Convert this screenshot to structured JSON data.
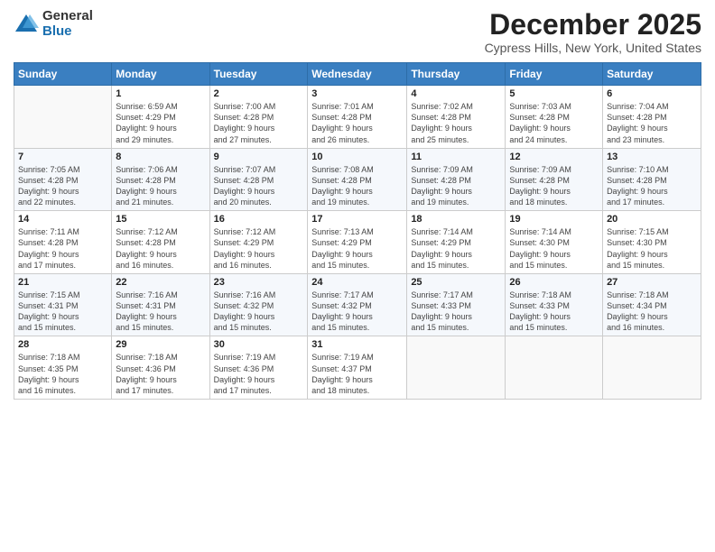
{
  "logo": {
    "general": "General",
    "blue": "Blue"
  },
  "title": "December 2025",
  "location": "Cypress Hills, New York, United States",
  "weekdays": [
    "Sunday",
    "Monday",
    "Tuesday",
    "Wednesday",
    "Thursday",
    "Friday",
    "Saturday"
  ],
  "weeks": [
    [
      {
        "day": "",
        "info": ""
      },
      {
        "day": "1",
        "info": "Sunrise: 6:59 AM\nSunset: 4:29 PM\nDaylight: 9 hours\nand 29 minutes."
      },
      {
        "day": "2",
        "info": "Sunrise: 7:00 AM\nSunset: 4:28 PM\nDaylight: 9 hours\nand 27 minutes."
      },
      {
        "day": "3",
        "info": "Sunrise: 7:01 AM\nSunset: 4:28 PM\nDaylight: 9 hours\nand 26 minutes."
      },
      {
        "day": "4",
        "info": "Sunrise: 7:02 AM\nSunset: 4:28 PM\nDaylight: 9 hours\nand 25 minutes."
      },
      {
        "day": "5",
        "info": "Sunrise: 7:03 AM\nSunset: 4:28 PM\nDaylight: 9 hours\nand 24 minutes."
      },
      {
        "day": "6",
        "info": "Sunrise: 7:04 AM\nSunset: 4:28 PM\nDaylight: 9 hours\nand 23 minutes."
      }
    ],
    [
      {
        "day": "7",
        "info": "Sunrise: 7:05 AM\nSunset: 4:28 PM\nDaylight: 9 hours\nand 22 minutes."
      },
      {
        "day": "8",
        "info": "Sunrise: 7:06 AM\nSunset: 4:28 PM\nDaylight: 9 hours\nand 21 minutes."
      },
      {
        "day": "9",
        "info": "Sunrise: 7:07 AM\nSunset: 4:28 PM\nDaylight: 9 hours\nand 20 minutes."
      },
      {
        "day": "10",
        "info": "Sunrise: 7:08 AM\nSunset: 4:28 PM\nDaylight: 9 hours\nand 19 minutes."
      },
      {
        "day": "11",
        "info": "Sunrise: 7:09 AM\nSunset: 4:28 PM\nDaylight: 9 hours\nand 19 minutes."
      },
      {
        "day": "12",
        "info": "Sunrise: 7:09 AM\nSunset: 4:28 PM\nDaylight: 9 hours\nand 18 minutes."
      },
      {
        "day": "13",
        "info": "Sunrise: 7:10 AM\nSunset: 4:28 PM\nDaylight: 9 hours\nand 17 minutes."
      }
    ],
    [
      {
        "day": "14",
        "info": "Sunrise: 7:11 AM\nSunset: 4:28 PM\nDaylight: 9 hours\nand 17 minutes."
      },
      {
        "day": "15",
        "info": "Sunrise: 7:12 AM\nSunset: 4:28 PM\nDaylight: 9 hours\nand 16 minutes."
      },
      {
        "day": "16",
        "info": "Sunrise: 7:12 AM\nSunset: 4:29 PM\nDaylight: 9 hours\nand 16 minutes."
      },
      {
        "day": "17",
        "info": "Sunrise: 7:13 AM\nSunset: 4:29 PM\nDaylight: 9 hours\nand 15 minutes."
      },
      {
        "day": "18",
        "info": "Sunrise: 7:14 AM\nSunset: 4:29 PM\nDaylight: 9 hours\nand 15 minutes."
      },
      {
        "day": "19",
        "info": "Sunrise: 7:14 AM\nSunset: 4:30 PM\nDaylight: 9 hours\nand 15 minutes."
      },
      {
        "day": "20",
        "info": "Sunrise: 7:15 AM\nSunset: 4:30 PM\nDaylight: 9 hours\nand 15 minutes."
      }
    ],
    [
      {
        "day": "21",
        "info": "Sunrise: 7:15 AM\nSunset: 4:31 PM\nDaylight: 9 hours\nand 15 minutes."
      },
      {
        "day": "22",
        "info": "Sunrise: 7:16 AM\nSunset: 4:31 PM\nDaylight: 9 hours\nand 15 minutes."
      },
      {
        "day": "23",
        "info": "Sunrise: 7:16 AM\nSunset: 4:32 PM\nDaylight: 9 hours\nand 15 minutes."
      },
      {
        "day": "24",
        "info": "Sunrise: 7:17 AM\nSunset: 4:32 PM\nDaylight: 9 hours\nand 15 minutes."
      },
      {
        "day": "25",
        "info": "Sunrise: 7:17 AM\nSunset: 4:33 PM\nDaylight: 9 hours\nand 15 minutes."
      },
      {
        "day": "26",
        "info": "Sunrise: 7:18 AM\nSunset: 4:33 PM\nDaylight: 9 hours\nand 15 minutes."
      },
      {
        "day": "27",
        "info": "Sunrise: 7:18 AM\nSunset: 4:34 PM\nDaylight: 9 hours\nand 16 minutes."
      }
    ],
    [
      {
        "day": "28",
        "info": "Sunrise: 7:18 AM\nSunset: 4:35 PM\nDaylight: 9 hours\nand 16 minutes."
      },
      {
        "day": "29",
        "info": "Sunrise: 7:18 AM\nSunset: 4:36 PM\nDaylight: 9 hours\nand 17 minutes."
      },
      {
        "day": "30",
        "info": "Sunrise: 7:19 AM\nSunset: 4:36 PM\nDaylight: 9 hours\nand 17 minutes."
      },
      {
        "day": "31",
        "info": "Sunrise: 7:19 AM\nSunset: 4:37 PM\nDaylight: 9 hours\nand 18 minutes."
      },
      {
        "day": "",
        "info": ""
      },
      {
        "day": "",
        "info": ""
      },
      {
        "day": "",
        "info": ""
      }
    ]
  ]
}
